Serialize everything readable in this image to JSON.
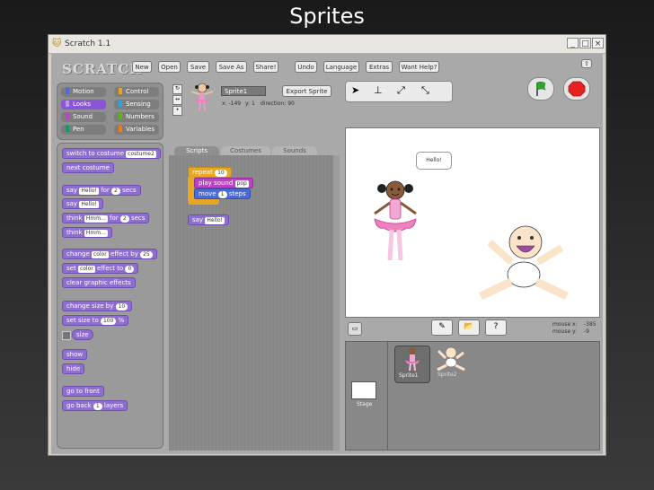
{
  "slide": {
    "title": "Sprites"
  },
  "window": {
    "title": "Scratch 1.1",
    "minimize": "_",
    "maximize": "□",
    "close": "×"
  },
  "app": {
    "logo": "SCRATCH"
  },
  "menu": [
    "New",
    "Open",
    "Save",
    "Save As",
    "Share!",
    "Undo",
    "Language",
    "Extras",
    "Want Help?"
  ],
  "categories": [
    {
      "label": "Motion",
      "color": "#4a6cd4"
    },
    {
      "label": "Control",
      "color": "#e6a822"
    },
    {
      "label": "Looks",
      "color": "#8a55d7"
    },
    {
      "label": "Sensing",
      "color": "#2ca5e2"
    },
    {
      "label": "Sound",
      "color": "#bb42c3"
    },
    {
      "label": "Numbers",
      "color": "#5cb712"
    },
    {
      "label": "Pen",
      "color": "#0e9a6c"
    },
    {
      "label": "Variables",
      "color": "#ee7d16"
    }
  ],
  "palette": {
    "switch_costume": "switch to costume",
    "costume_value": "costume2",
    "next_costume": "next costume",
    "say_for_a": "say",
    "say_for_text": "Hello!",
    "say_for_b": "for",
    "say_for_num": "2",
    "say_for_c": "secs",
    "say": "say",
    "say_text": "Hello!",
    "think_for_a": "think",
    "think_for_text": "Hmm...",
    "think_for_b": "for",
    "think_for_num": "2",
    "think_for_c": "secs",
    "think": "think",
    "think_text": "Hmm...",
    "change_effect_a": "change",
    "change_effect_val": "color",
    "change_effect_b": "effect by",
    "change_effect_num": "25",
    "set_effect_a": "set",
    "set_effect_val": "color",
    "set_effect_b": "effect to",
    "set_effect_num": "0",
    "clear_effects": "clear graphic effects",
    "change_size_a": "change size by",
    "change_size_num": "10",
    "set_size_a": "set size to",
    "set_size_num": "100",
    "set_size_b": "%",
    "size": "size",
    "show": "show",
    "hide": "hide",
    "front": "go to front",
    "back_a": "go back",
    "back_num": "1",
    "back_b": "layers"
  },
  "sprite_info": {
    "name": "Sprite1",
    "export": "Export Sprite",
    "x": "x: -149",
    "y": "y: 1",
    "direction": "direction: 90"
  },
  "tabs": [
    "Scripts",
    "Costumes",
    "Sounds"
  ],
  "script": {
    "repeat": "repeat",
    "repeat_num": "10",
    "play_sound": "play sound",
    "sound_name": "pop",
    "move_a": "move",
    "move_num": "1",
    "move_b": "steps",
    "say": "say",
    "say_text": "Hello!"
  },
  "stage": {
    "speech": "Hello!",
    "mouse_x_label": "mouse x:",
    "mouse_x": "-385",
    "mouse_y_label": "mouse y:",
    "mouse_y": "-9"
  },
  "sprites": [
    {
      "name": "Sprite1"
    },
    {
      "name": "Sprite2"
    }
  ],
  "stage_thumb": {
    "label": "Stage"
  }
}
